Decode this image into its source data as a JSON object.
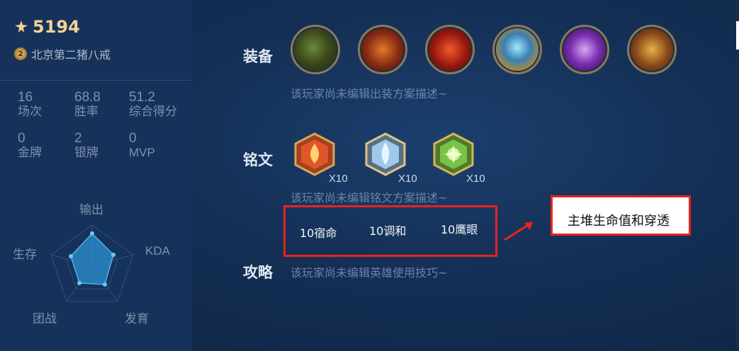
{
  "profile": {
    "score": "5194",
    "region": "北京第二猪八戒",
    "medal_level": "2"
  },
  "stats": [
    {
      "value": "16",
      "label": "场次"
    },
    {
      "value": "68.8",
      "label": "胜率"
    },
    {
      "value": "51.2",
      "label": "综合得分"
    },
    {
      "value": "0",
      "label": "金牌"
    },
    {
      "value": "2",
      "label": "银牌"
    },
    {
      "value": "0",
      "label": "MVP"
    }
  ],
  "radar": {
    "labels": [
      "输出",
      "KDA",
      "发育",
      "团战",
      "生存"
    ]
  },
  "equipment": {
    "title": "装备",
    "description": "该玩家尚未编辑出装方案描述~",
    "items": [
      {
        "icon": "boots-item-icon"
      },
      {
        "icon": "armor-item-icon"
      },
      {
        "icon": "fire-orb-item-icon"
      },
      {
        "icon": "crystal-shield-item-icon"
      },
      {
        "icon": "purple-axe-item-icon"
      },
      {
        "icon": "golden-armor-item-icon"
      }
    ]
  },
  "runes": {
    "title": "铭文",
    "description": "该玩家尚未编辑铭文方案描述~",
    "items": [
      {
        "icon": "red-rune-icon",
        "count": "X10",
        "color": "#e0562a"
      },
      {
        "icon": "blue-rune-icon",
        "count": "X10",
        "color": "#7bb6e8"
      },
      {
        "icon": "green-rune-icon",
        "count": "X10",
        "color": "#79c24a"
      }
    ]
  },
  "strategy": {
    "title": "攻略",
    "description": "该玩家尚未编辑英雄使用技巧~"
  },
  "annotations": {
    "rune_names": [
      "10宿命",
      "10调和",
      "10鹰眼"
    ],
    "tip": "主堆生命值和穿透",
    "box_color": "#e8231e"
  }
}
